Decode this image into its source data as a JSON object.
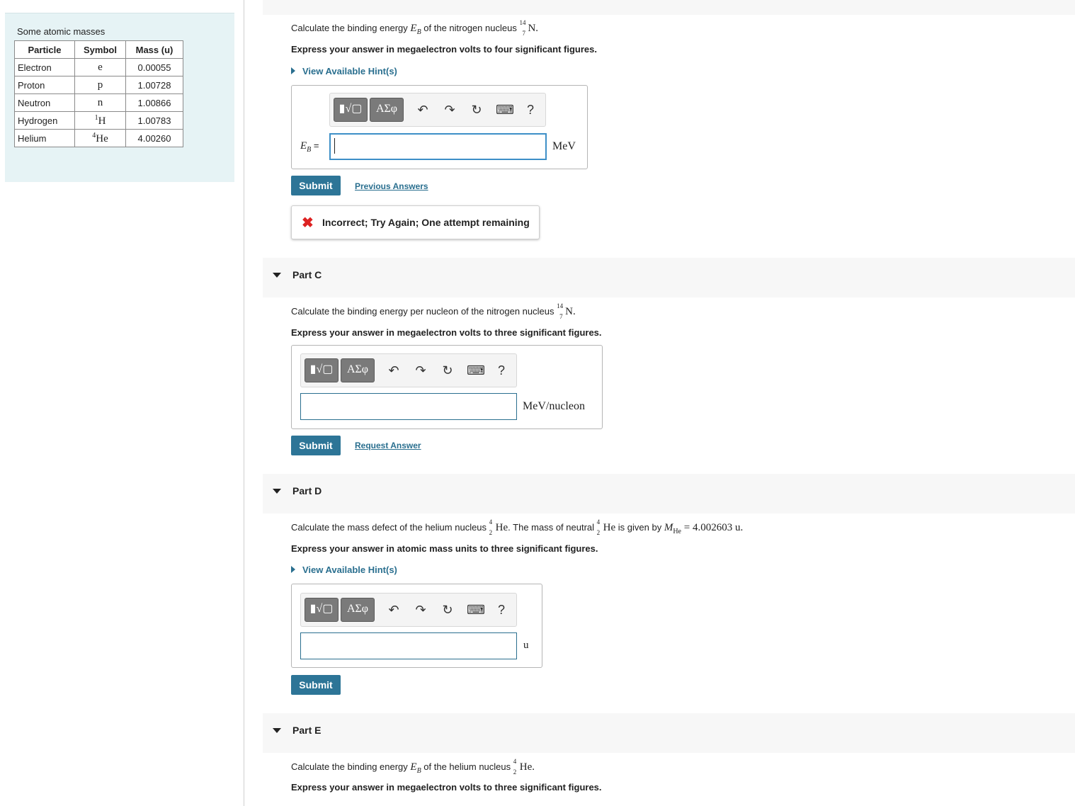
{
  "masses_table": {
    "title": "Some atomic masses",
    "headers": [
      "Particle",
      "Symbol",
      "Mass (u)"
    ],
    "rows": [
      {
        "particle": "Electron",
        "symbol": "e",
        "mass": "0.00055"
      },
      {
        "particle": "Proton",
        "symbol": "p",
        "mass": "1.00728"
      },
      {
        "particle": "Neutron",
        "symbol": "n",
        "mass": "1.00866"
      },
      {
        "particle": "Hydrogen",
        "symbol_sup": "1",
        "symbol_main": "H",
        "mass": "1.00783"
      },
      {
        "particle": "Helium",
        "symbol_sup": "4",
        "symbol_main": "He",
        "mass": "4.00260"
      }
    ]
  },
  "part_b": {
    "question_pre": "Calculate the binding energy ",
    "question_var": "E",
    "question_var_sub": "B",
    "question_mid": " of the nitrogen nucleus ",
    "nucleus": {
      "mass_number": "14",
      "atomic_number": "7",
      "symbol": "N"
    },
    "question_end": ".",
    "instruction": "Express your answer in megaelectron volts to four significant figures.",
    "hint_label": "View Available Hint(s)",
    "input_label_var": "E",
    "input_label_sub": "B",
    "input_label_eq": " =",
    "unit": "MeV",
    "submit_label": "Submit",
    "previous_answers_label": "Previous Answers",
    "feedback": "Incorrect; Try Again; One attempt remaining"
  },
  "part_c": {
    "header": "Part C",
    "question_pre": "Calculate the binding energy per nucleon of the nitrogen nucleus ",
    "nucleus": {
      "mass_number": "14",
      "atomic_number": "7",
      "symbol": "N"
    },
    "question_end": ".",
    "instruction": "Express your answer in megaelectron volts to three significant figures.",
    "unit": "MeV/nucleon",
    "submit_label": "Submit",
    "request_answer_label": "Request Answer"
  },
  "part_d": {
    "header": "Part D",
    "question_pre": "Calculate the mass defect of the helium nucleus ",
    "nucleus": {
      "mass_number": "4",
      "atomic_number": "2",
      "symbol": "He"
    },
    "question_mid": ". The mass of neutral ",
    "question_mid2": " is given by ",
    "mass_var": "M",
    "mass_sub": "He",
    "mass_value": " = 4.002603 u.",
    "instruction": "Express your answer in atomic mass units to three significant figures.",
    "hint_label": "View Available Hint(s)",
    "unit": "u",
    "submit_label": "Submit"
  },
  "part_e": {
    "header": "Part E",
    "question_pre": "Calculate the binding energy ",
    "question_var": "E",
    "question_var_sub": "B",
    "question_mid": " of the helium nucleus ",
    "nucleus": {
      "mass_number": "4",
      "atomic_number": "2",
      "symbol": "He"
    },
    "question_end": ".",
    "instruction": "Express your answer in megaelectron volts to three significant figures."
  },
  "toolbar": {
    "templates_label": "▮√▢",
    "symbols_label": "ΑΣφ",
    "undo_icon": "↶",
    "redo_icon": "↷",
    "reset_icon": "↻",
    "keyboard_icon": "⌨",
    "help_label": "?"
  }
}
